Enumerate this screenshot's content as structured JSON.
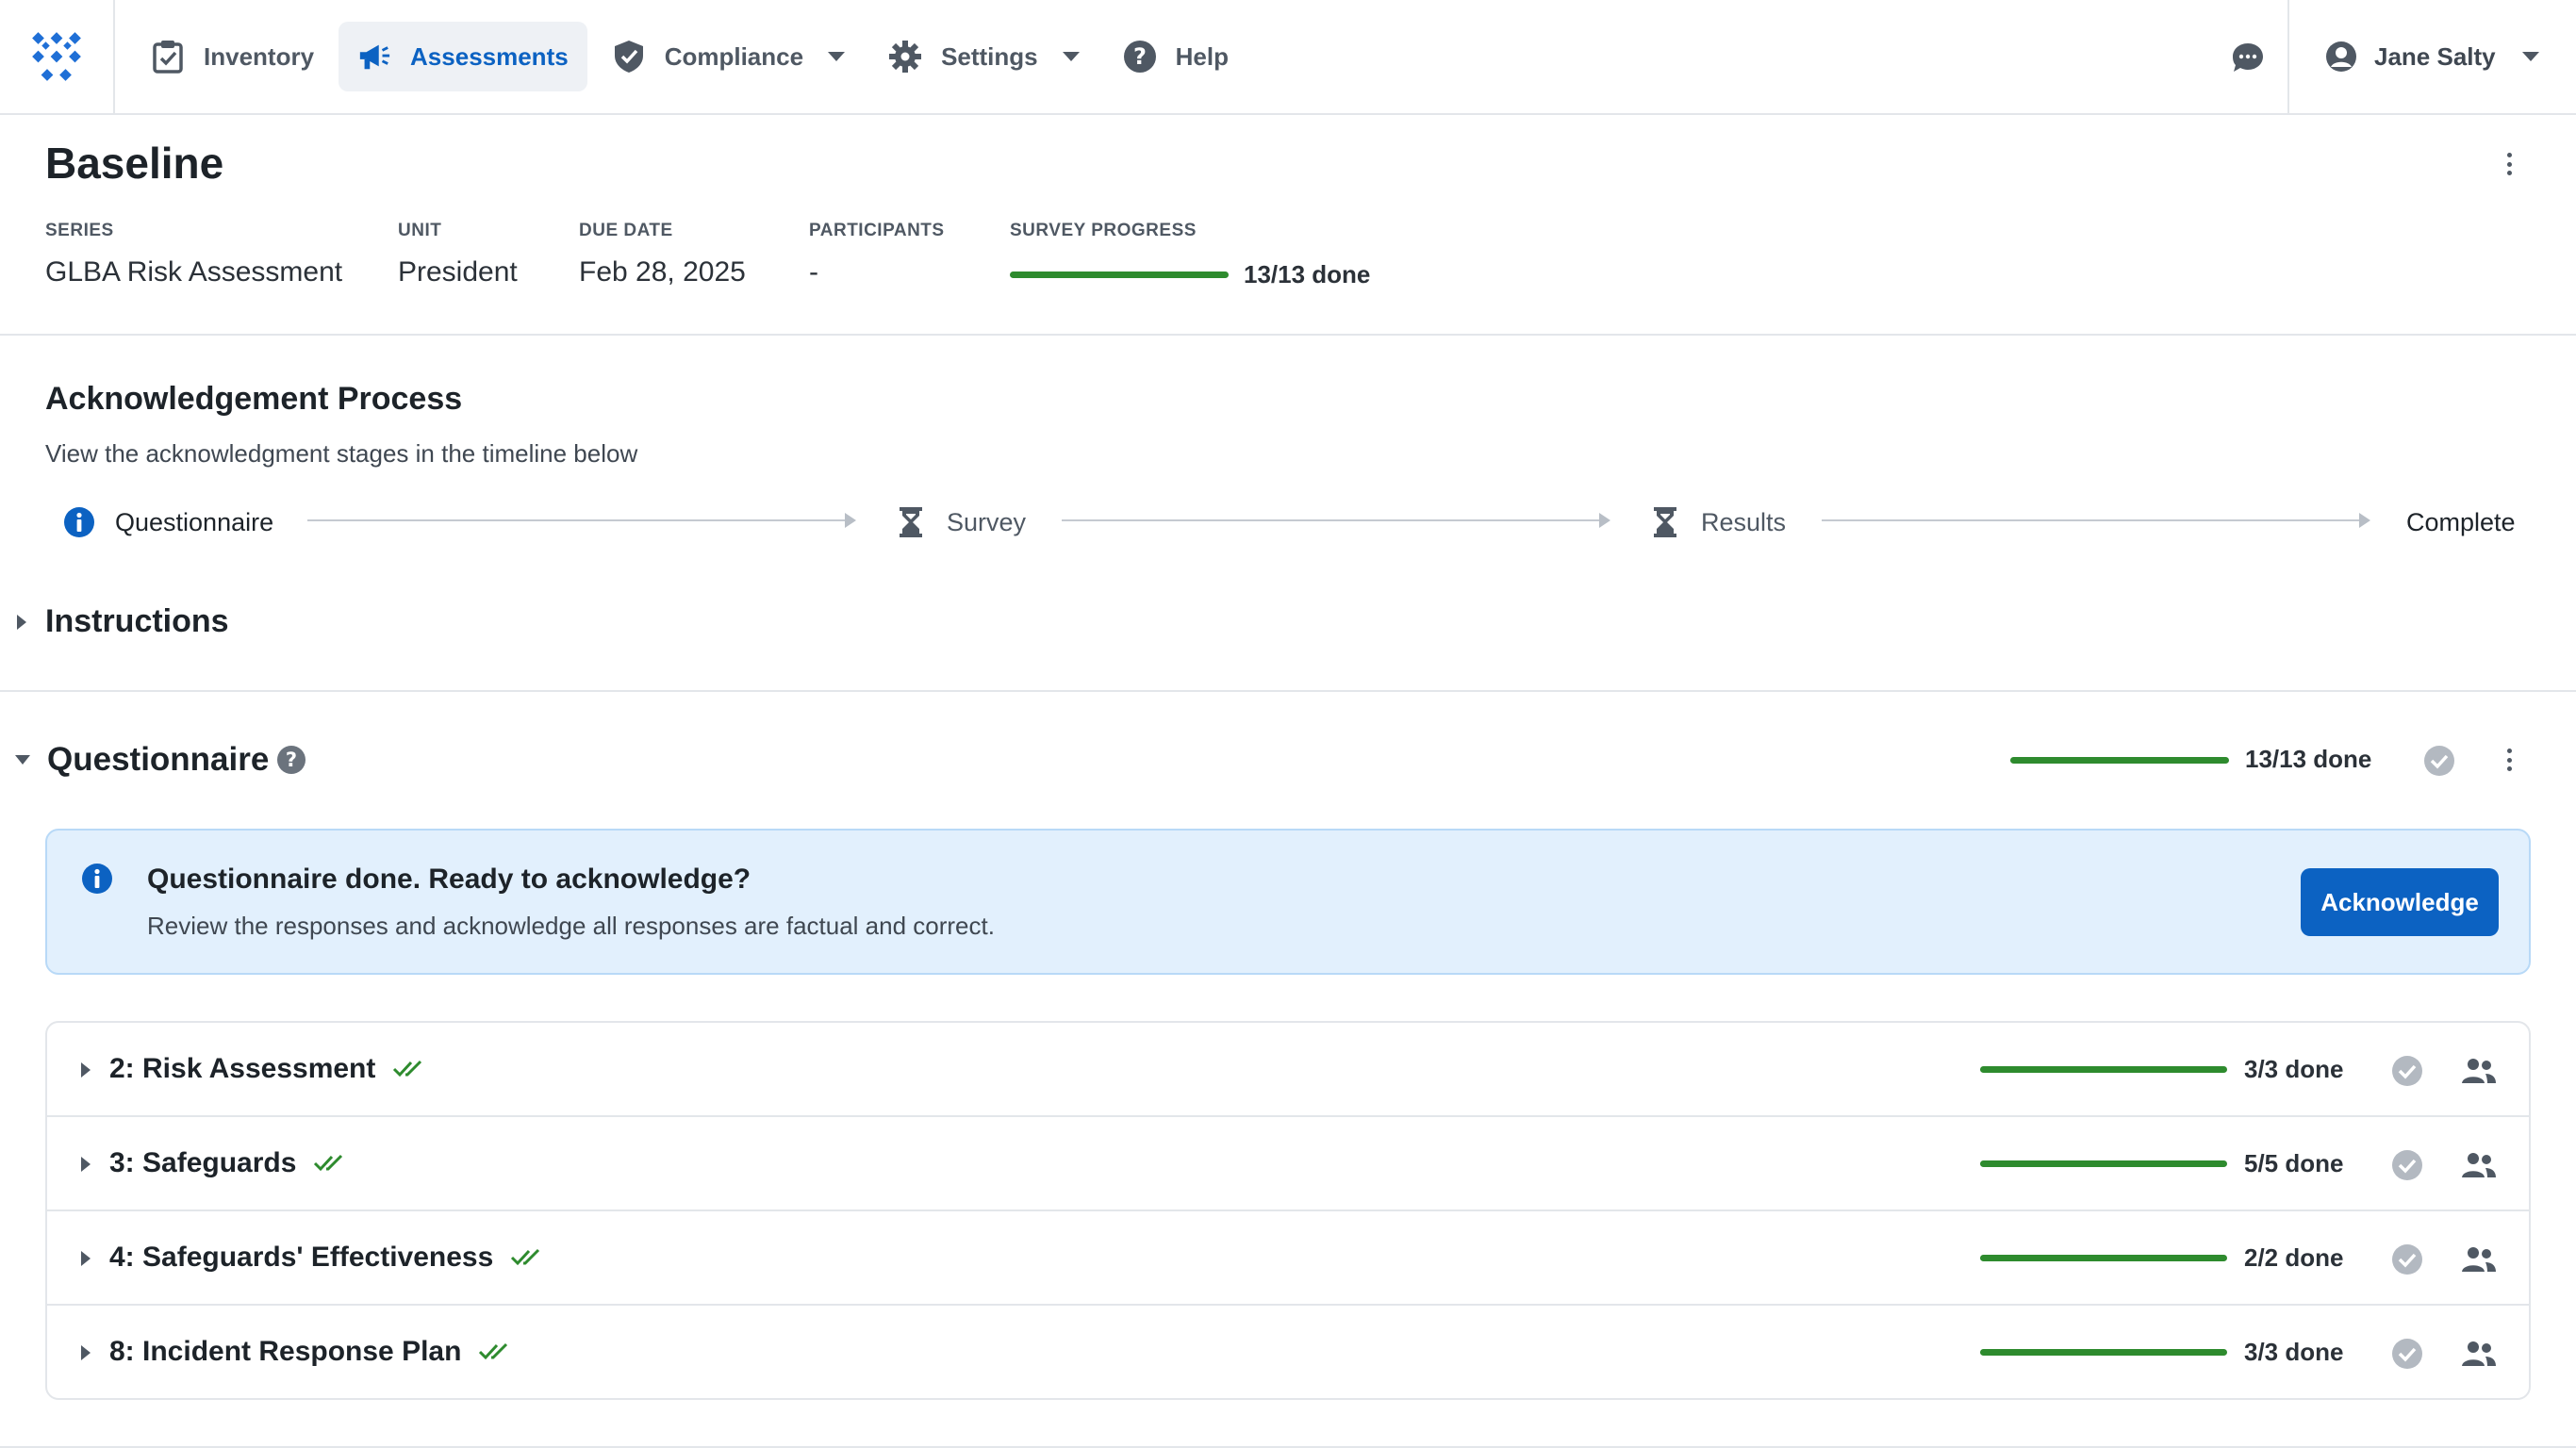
{
  "nav": {
    "items": [
      {
        "label": "Inventory",
        "icon": "clipboard-check-icon",
        "active": false
      },
      {
        "label": "Assessments",
        "icon": "megaphone-icon",
        "active": true
      },
      {
        "label": "Compliance",
        "icon": "shield-check-icon",
        "active": false,
        "dropdown": true
      },
      {
        "label": "Settings",
        "icon": "gear-icon",
        "active": false,
        "dropdown": true
      },
      {
        "label": "Help",
        "icon": "question-circle-icon",
        "active": false
      }
    ],
    "user_name": "Jane Salty"
  },
  "header": {
    "title": "Baseline",
    "meta": {
      "series_label": "SERIES",
      "series_value": "GLBA Risk Assessment",
      "unit_label": "UNIT",
      "unit_value": "President",
      "due_label": "DUE DATE",
      "due_value": "Feb 28, 2025",
      "participants_label": "PARTICIPANTS",
      "participants_value": "-",
      "progress_label": "SURVEY PROGRESS",
      "progress_text": "13/13 done",
      "progress_fraction": 1.0
    }
  },
  "process": {
    "title": "Acknowledgement Process",
    "subtitle": "View the acknowledgment stages in the timeline below",
    "steps": [
      {
        "label": "Questionnaire",
        "icon": "info-circle-icon",
        "state": "current"
      },
      {
        "label": "Survey",
        "icon": "hourglass-icon",
        "state": "pending"
      },
      {
        "label": "Results",
        "icon": "hourglass-icon",
        "state": "pending"
      },
      {
        "label": "Complete",
        "icon": "",
        "state": "pending"
      }
    ]
  },
  "instructions": {
    "title": "Instructions"
  },
  "questionnaire": {
    "title": "Questionnaire",
    "progress_text": "13/13 done",
    "progress_fraction": 1.0,
    "banner": {
      "heading": "Questionnaire done. Ready to acknowledge?",
      "body": "Review the responses and acknowledge all responses are factual and correct.",
      "button": "Acknowledge"
    },
    "sections": [
      {
        "name": "2: Risk Assessment",
        "done": "3/3 done",
        "fraction": 1.0
      },
      {
        "name": "3: Safeguards",
        "done": "5/5 done",
        "fraction": 1.0
      },
      {
        "name": "4: Safeguards' Effectiveness",
        "done": "2/2 done",
        "fraction": 1.0
      },
      {
        "name": "8: Incident Response Plan",
        "done": "3/3 done",
        "fraction": 1.0
      }
    ]
  },
  "colors": {
    "accent": "#0c62c2",
    "success": "#2e8b2e",
    "banner_bg": "#e2f0fd"
  }
}
